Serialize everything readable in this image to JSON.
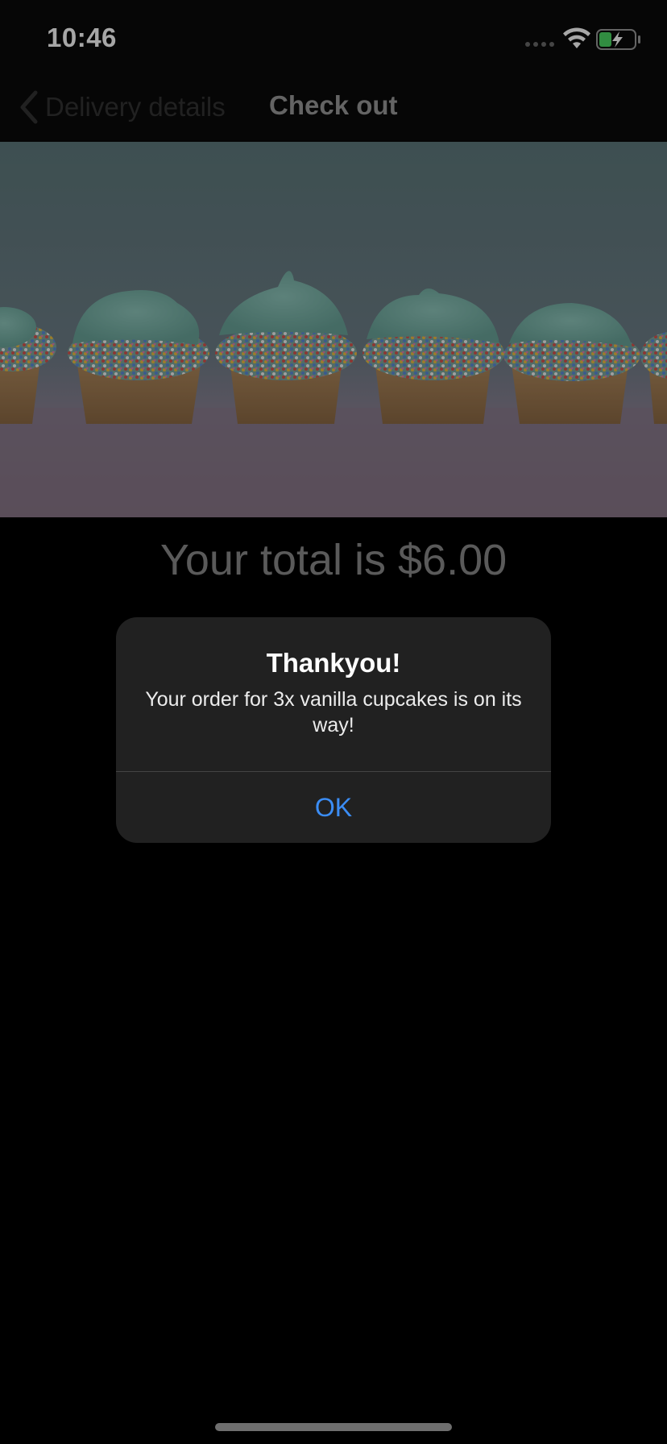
{
  "status_bar": {
    "time": "10:46",
    "icons": [
      "signal-dots-icon",
      "wifi-icon",
      "battery-charging-icon"
    ],
    "battery_color": "#4cd964"
  },
  "nav": {
    "back_label": "Delivery details",
    "title": "Check out"
  },
  "hero": {
    "image": "cupcakes-photo"
  },
  "total": {
    "text": "Your total is $6.00"
  },
  "alert": {
    "title": "Thankyou!",
    "message": "Your order for 3x vanilla cupcakes is on its way!",
    "ok_label": "OK",
    "ok_color": "#3b8df5"
  }
}
